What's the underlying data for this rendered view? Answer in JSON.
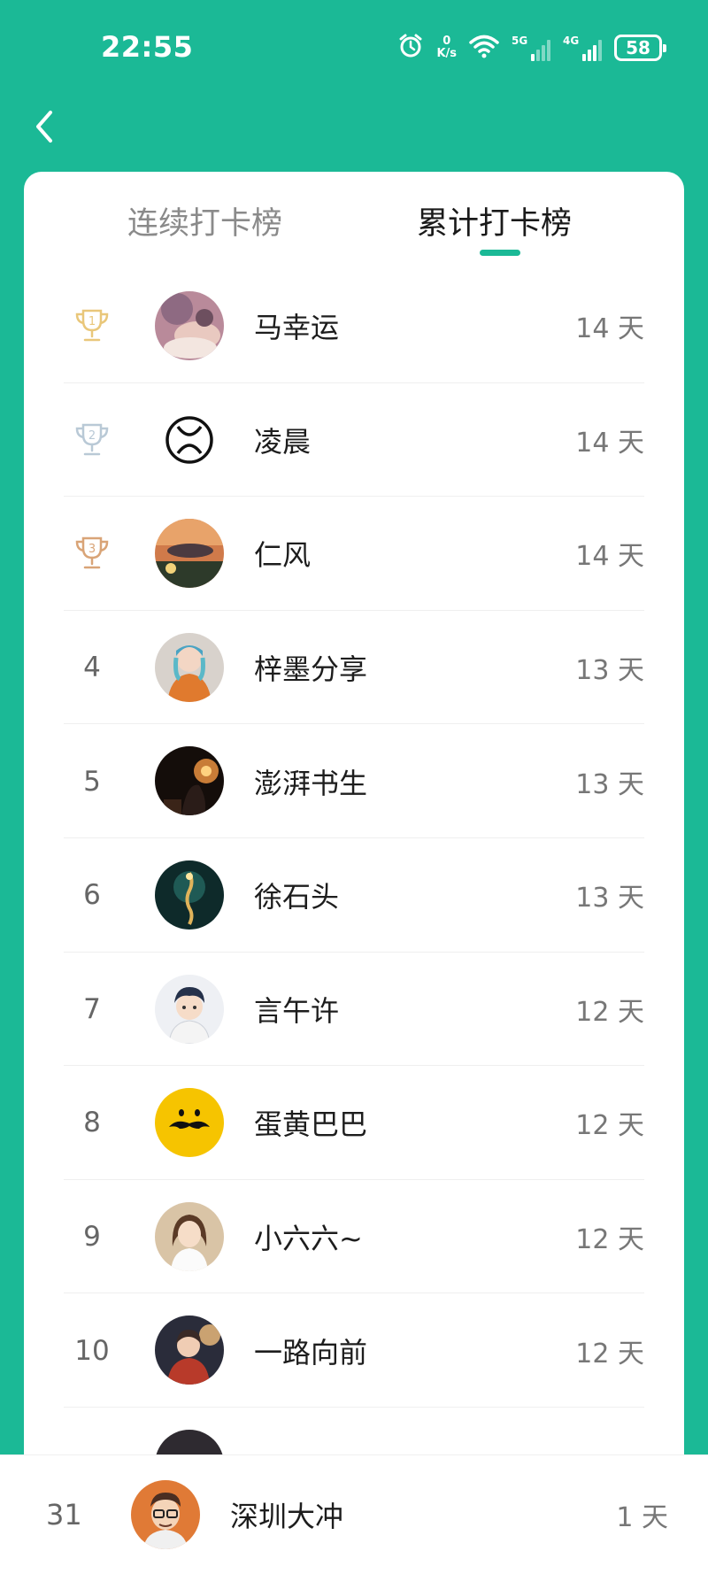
{
  "status_bar": {
    "time": "22:55",
    "net_speed_value": "0",
    "net_speed_unit": "K/s",
    "signal_1_label": "5G",
    "signal_2_label": "4G",
    "battery": "58",
    "icons": [
      "alarm-icon",
      "wifi-icon",
      "signal-icon",
      "battery-icon"
    ]
  },
  "header": {
    "back_icon": "chevron-left-icon"
  },
  "tabs": [
    {
      "label": "连续打卡榜",
      "active": false
    },
    {
      "label": "累计打卡榜",
      "active": true
    }
  ],
  "colors": {
    "accent": "#1bb996",
    "gold": "#e9c77a",
    "silver": "#b9c9d6",
    "bronze": "#d9a477"
  },
  "ranking": [
    {
      "rank": "1",
      "name": "马幸运",
      "days": "14 天",
      "medal": "gold"
    },
    {
      "rank": "2",
      "name": "凌晨",
      "days": "14 天",
      "medal": "silver"
    },
    {
      "rank": "3",
      "name": "仁风",
      "days": "14 天",
      "medal": "bronze"
    },
    {
      "rank": "4",
      "name": "梓墨分享",
      "days": "13 天"
    },
    {
      "rank": "5",
      "name": "澎湃书生",
      "days": "13 天"
    },
    {
      "rank": "6",
      "name": "徐石头",
      "days": "13 天"
    },
    {
      "rank": "7",
      "name": "言午许",
      "days": "12 天"
    },
    {
      "rank": "8",
      "name": "蛋黄巴巴",
      "days": "12 天"
    },
    {
      "rank": "9",
      "name": "小六六~",
      "days": "12 天"
    },
    {
      "rank": "10",
      "name": "一路向前",
      "days": "12 天"
    }
  ],
  "self": {
    "rank": "31",
    "name": "深圳大冲",
    "days": "1 天"
  }
}
